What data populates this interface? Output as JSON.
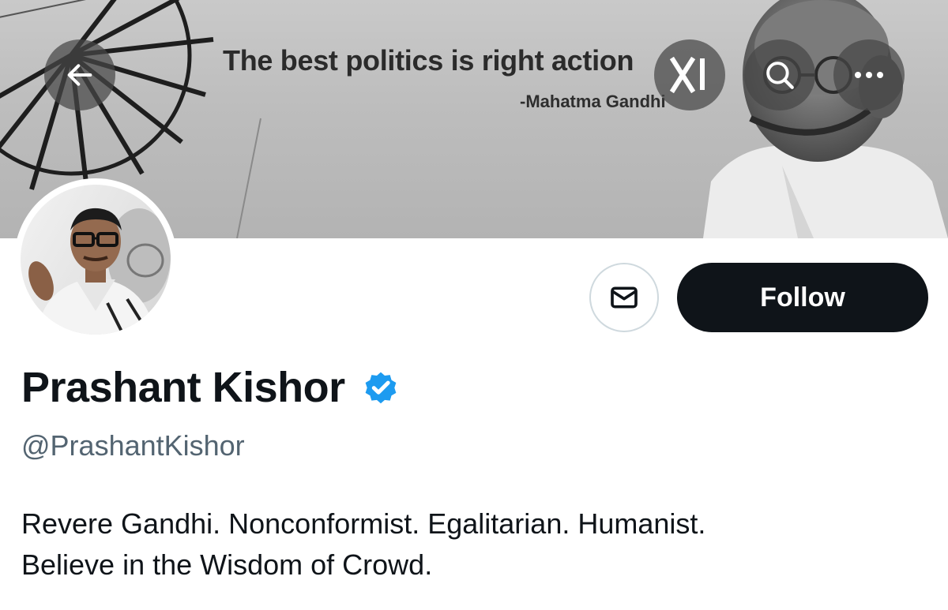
{
  "banner": {
    "quote": "The best politics is right action",
    "quote_author": "-Mahatma Gandhi"
  },
  "overlay_buttons": {
    "back_icon": "arrow-left-icon",
    "xai_icon": "xai-logo-icon",
    "search_icon": "search-icon",
    "more_icon": "more-horizontal-icon"
  },
  "profile": {
    "display_name": "Prashant Kishor",
    "verified": true,
    "verified_color": "#1d9bf0",
    "handle": "@PrashantKishor",
    "bio_lines": [
      "Revere Gandhi. Nonconformist. Egalitarian. Humanist.",
      "Believe in the Wisdom of Crowd."
    ]
  },
  "actions": {
    "message_icon": "mail-icon",
    "follow_label": "Follow"
  },
  "colors": {
    "text_primary": "#0f1419",
    "text_secondary": "#536471",
    "follow_bg": "#0f1419",
    "border": "#cfd9de"
  }
}
